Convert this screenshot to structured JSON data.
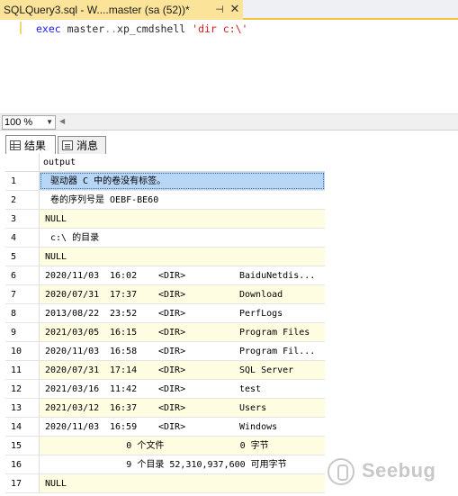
{
  "document_tab": {
    "title": "SQLQuery3.sql - W....master (sa (52))*",
    "pin_icon": "pin-icon",
    "close_icon": "close-icon"
  },
  "editor": {
    "keyword": "exec",
    "object": "master",
    "separator": "..",
    "procedure": "xp_cmdshell",
    "string": "'dir c:\\'"
  },
  "zoom": {
    "value": "100 %"
  },
  "result_tabs": [
    {
      "label": "结果",
      "icon": "grid-icon"
    },
    {
      "label": "消息",
      "icon": "message-icon"
    }
  ],
  "grid": {
    "column_header": "output",
    "rows": [
      {
        "num": "1",
        "text": " 驱动器 C 中的卷没有标签。"
      },
      {
        "num": "2",
        "text": " 卷的序列号是 OEBF-BE60"
      },
      {
        "num": "3",
        "text": "NULL"
      },
      {
        "num": "4",
        "text": " c:\\ 的目录"
      },
      {
        "num": "5",
        "text": "NULL"
      },
      {
        "num": "6",
        "date": "2020/11/03",
        "time": "16:02",
        "dir": "<DIR>",
        "name": "BaiduNetdis..."
      },
      {
        "num": "7",
        "date": "2020/07/31",
        "time": "17:37",
        "dir": "<DIR>",
        "name": "Download"
      },
      {
        "num": "8",
        "date": "2013/08/22",
        "time": "23:52",
        "dir": "<DIR>",
        "name": "PerfLogs"
      },
      {
        "num": "9",
        "date": "2021/03/05",
        "time": "16:15",
        "dir": "<DIR>",
        "name": "Program Files"
      },
      {
        "num": "10",
        "date": "2020/11/03",
        "time": "16:58",
        "dir": "<DIR>",
        "name": "Program Fil..."
      },
      {
        "num": "11",
        "date": "2020/07/31",
        "time": "17:14",
        "dir": "<DIR>",
        "name": "SQL Server"
      },
      {
        "num": "12",
        "date": "2021/03/16",
        "time": "11:42",
        "dir": "<DIR>",
        "name": "test"
      },
      {
        "num": "13",
        "date": "2021/03/12",
        "time": "16:37",
        "dir": "<DIR>",
        "name": "Users"
      },
      {
        "num": "14",
        "date": "2020/11/03",
        "time": "16:59",
        "dir": "<DIR>",
        "name": "Windows"
      },
      {
        "num": "15",
        "text": "               0 个文件              0 字节"
      },
      {
        "num": "16",
        "text": "               9 个目录 52,310,937,600 可用字节"
      },
      {
        "num": "17",
        "text": "NULL"
      }
    ]
  },
  "watermark": {
    "text": "Seebug"
  }
}
